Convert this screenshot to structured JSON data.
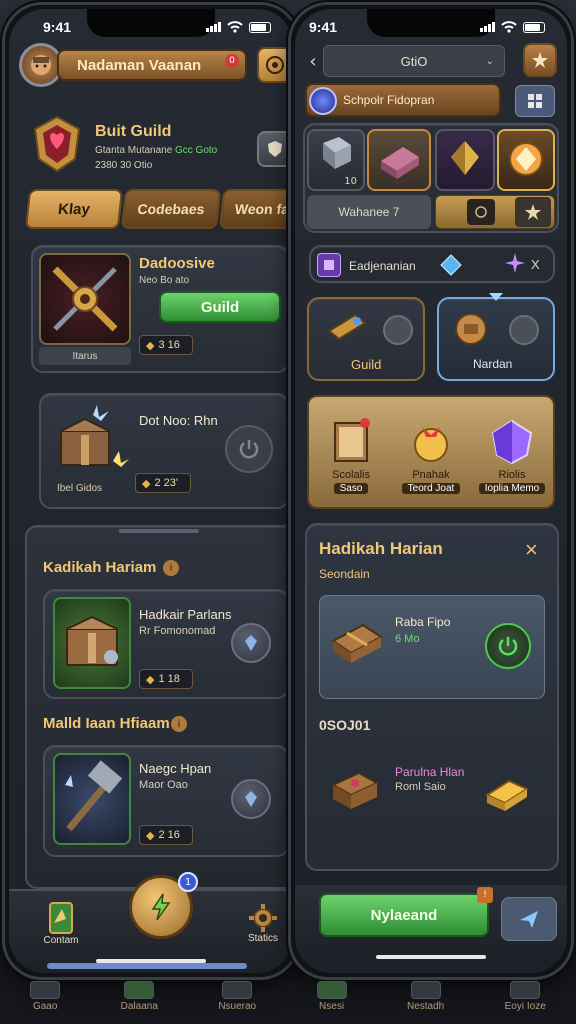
{
  "status_bar": {
    "time_left": "9:41",
    "time_right": "9:41"
  },
  "left": {
    "header": {
      "title": "Nadaman Vaanan",
      "badge": "0"
    },
    "guild": {
      "title": "Buit Guild",
      "line1": "Gtanta Mutanane",
      "line1_green": "Gcc Goto",
      "line2": "2380 30 Otio"
    },
    "tabs": [
      "Klay",
      "Codebaes",
      "Weon fa"
    ],
    "item1": {
      "title": "Dadoosive",
      "subtitle": "Neo Bo ato",
      "button": "Guild",
      "caption": "Itarus",
      "price": "3 16"
    },
    "item2": {
      "title": "Dot Noo: Rhn",
      "caption": "Ibel Gidos",
      "price": "2 23'"
    },
    "daily": {
      "title": "Kadikah Hariam",
      "row1": {
        "title": "Hadkair Parlans",
        "subtitle": "Rr Fomonomad",
        "price": "1 18"
      },
      "section2_title": "Malld Iaan Hfiaam",
      "row2": {
        "title": "Naegc Hpan",
        "subtitle": "Maor Oao",
        "price": "2 16"
      }
    },
    "nav": {
      "left": "Contam",
      "right": "Statics",
      "badge": "1"
    }
  },
  "right": {
    "header": {
      "title": "GtiO"
    },
    "subheader": {
      "title": "Schpolr Fidopran"
    },
    "item_strip": {
      "count1": "10",
      "caption": "Wahanee 7"
    },
    "tab_bar": {
      "label": "Eadjenanian",
      "close": "X"
    },
    "cards": {
      "left": "Guild",
      "right": "Nardan"
    },
    "rewards": [
      {
        "line1": "Scolalis",
        "line2": "Saso"
      },
      {
        "line1": "Pnahak",
        "line2": "Teord Joat"
      },
      {
        "line1": "Riolis",
        "line2": "Ioplia Memo"
      }
    ],
    "popup": {
      "title": "Hadikah Harian",
      "subtitle": "Seondain",
      "close": "×",
      "card_title": "Raba Fipo",
      "card_sub": "6 Mo",
      "code": "0SOJ01",
      "row_title": "Parulna Hlan",
      "row_sub": "Roml Saio",
      "button": "Nylaeand"
    }
  },
  "bottom_strip": [
    "Gaao",
    "Dalaana",
    "Nsuerao",
    "Nsesi",
    "Nestadh",
    "Eoyi Ioze"
  ]
}
